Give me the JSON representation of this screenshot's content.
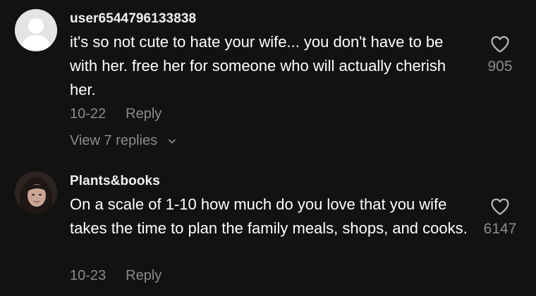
{
  "comments": [
    {
      "username": "user6544796133838",
      "text": "it's so not cute to hate your wife... you don't have to be with her. free her for someone who will actually cherish her.",
      "date": "10-22",
      "reply_label": "Reply",
      "view_replies_label": "View 7 replies",
      "likes": "905",
      "avatar": "default-avatar"
    },
    {
      "username": "Plants&books",
      "text": "On a scale of 1-10 how much do you love that you wife takes the time to plan the family meals, shops, and cooks.",
      "date": "10-23",
      "reply_label": "Reply",
      "likes": "6147",
      "avatar": "photo-avatar"
    }
  ],
  "icons": {
    "like": "heart-outline-icon",
    "expand": "chevron-down-icon"
  },
  "colors": {
    "background": "#121212",
    "primary_text": "#ffffff",
    "secondary_text": "#8b8b8b"
  }
}
